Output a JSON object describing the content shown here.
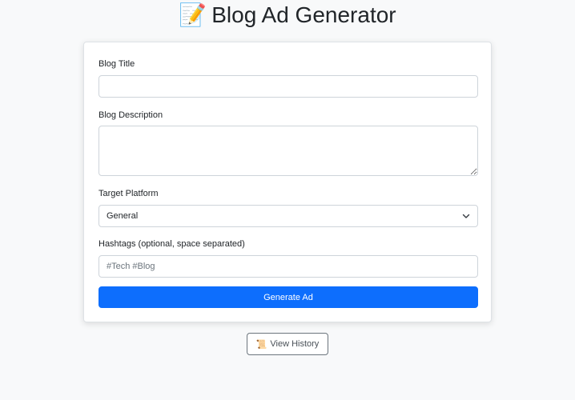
{
  "header": {
    "icon": "memo-icon",
    "emoji": "📝",
    "title": "Blog Ad Generator"
  },
  "form": {
    "blog_title_label": "Blog Title",
    "blog_title_value": "",
    "blog_description_label": "Blog Description",
    "blog_description_value": "",
    "platform_label": "Target Platform",
    "platform_selected": "General",
    "hashtags_label": "Hashtags (optional, space separated)",
    "hashtags_placeholder": "#Tech #Blog",
    "hashtags_value": "",
    "generate_label": "Generate Ad"
  },
  "history": {
    "icon": "scroll-icon",
    "emoji": "📜",
    "label": "View History"
  },
  "colors": {
    "primary": "#0d6efd",
    "background": "#f8f9fa",
    "border": "#ced4da"
  }
}
